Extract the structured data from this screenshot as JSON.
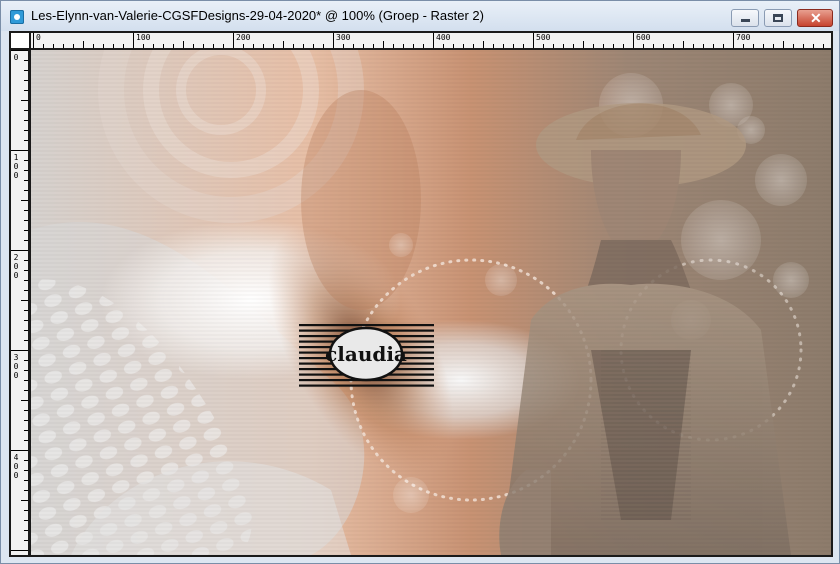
{
  "window": {
    "title": "Les-Elynn-van-Valerie-CGSFDesigns-29-04-2020* @ 100% (Groep - Raster 2)",
    "icon": "camera-icon",
    "controls": {
      "minimize": "minimize-icon",
      "maximize": "maximize-icon",
      "close": "close-icon",
      "close_glyph": "✕"
    }
  },
  "ruler": {
    "top_labels": [
      "0",
      "100",
      "200",
      "300",
      "400",
      "500",
      "600",
      "700"
    ],
    "left_labels": [
      "0",
      "100",
      "200",
      "300",
      "400"
    ]
  },
  "canvas": {
    "watermark": "claudia",
    "colors": {
      "peach": "#e8b595",
      "copper": "#b0734e",
      "taupe": "#8f7f6e",
      "grey": "#cfcfcf"
    }
  }
}
